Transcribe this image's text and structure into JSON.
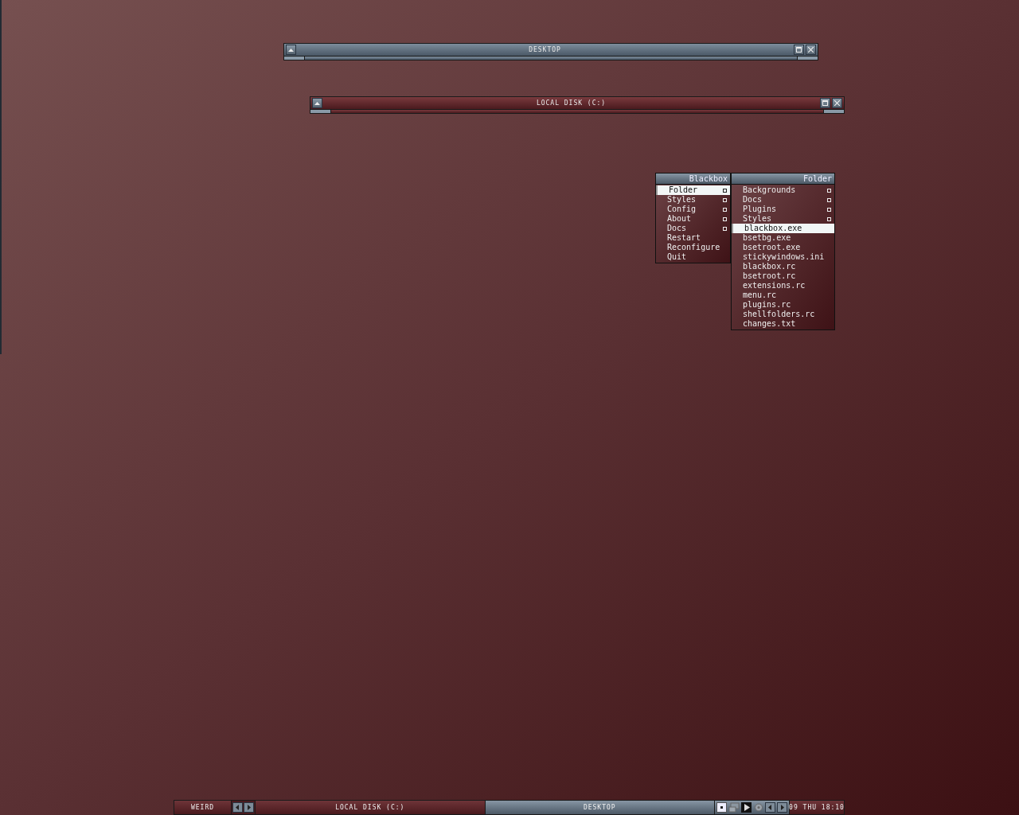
{
  "windows": [
    {
      "title": "DESKTOP",
      "focused": false
    },
    {
      "title": "LOCAL DISK (C:)",
      "focused": true
    }
  ],
  "menus": [
    {
      "title": "Blackbox",
      "items": [
        {
          "label": "Folder",
          "submenu": true,
          "selected": true
        },
        {
          "label": "Styles",
          "submenu": true,
          "selected": false
        },
        {
          "label": "Config",
          "submenu": true,
          "selected": false
        },
        {
          "label": "About",
          "submenu": true,
          "selected": false
        },
        {
          "label": "Docs",
          "submenu": true,
          "selected": false
        },
        {
          "label": "Restart",
          "submenu": false,
          "selected": false
        },
        {
          "label": "Reconfigure",
          "submenu": false,
          "selected": false
        },
        {
          "label": "Quit",
          "submenu": false,
          "selected": false
        }
      ]
    },
    {
      "title": "Folder",
      "items": [
        {
          "label": "Backgrounds",
          "submenu": true,
          "selected": false
        },
        {
          "label": "Docs",
          "submenu": true,
          "selected": false
        },
        {
          "label": "Plugins",
          "submenu": true,
          "selected": false
        },
        {
          "label": "Styles",
          "submenu": true,
          "selected": false
        },
        {
          "label": "blackbox.exe",
          "submenu": false,
          "selected": true
        },
        {
          "label": "bsetbg.exe",
          "submenu": false,
          "selected": false
        },
        {
          "label": "bsetroot.exe",
          "submenu": false,
          "selected": false
        },
        {
          "label": "stickywindows.ini",
          "submenu": false,
          "selected": false
        },
        {
          "label": "blackbox.rc",
          "submenu": false,
          "selected": false
        },
        {
          "label": "bsetroot.rc",
          "submenu": false,
          "selected": false
        },
        {
          "label": "extensions.rc",
          "submenu": false,
          "selected": false
        },
        {
          "label": "menu.rc",
          "submenu": false,
          "selected": false
        },
        {
          "label": "plugins.rc",
          "submenu": false,
          "selected": false
        },
        {
          "label": "shellfolders.rc",
          "submenu": false,
          "selected": false
        },
        {
          "label": "changes.txt",
          "submenu": false,
          "selected": false
        }
      ]
    }
  ],
  "taskbar": {
    "workspace": "WEIRD",
    "tasks": [
      {
        "label": "LOCAL DISK (C:)",
        "selected": true
      },
      {
        "label": "DESKTOP",
        "selected": false
      }
    ],
    "clock": "09 THU 18:10"
  }
}
